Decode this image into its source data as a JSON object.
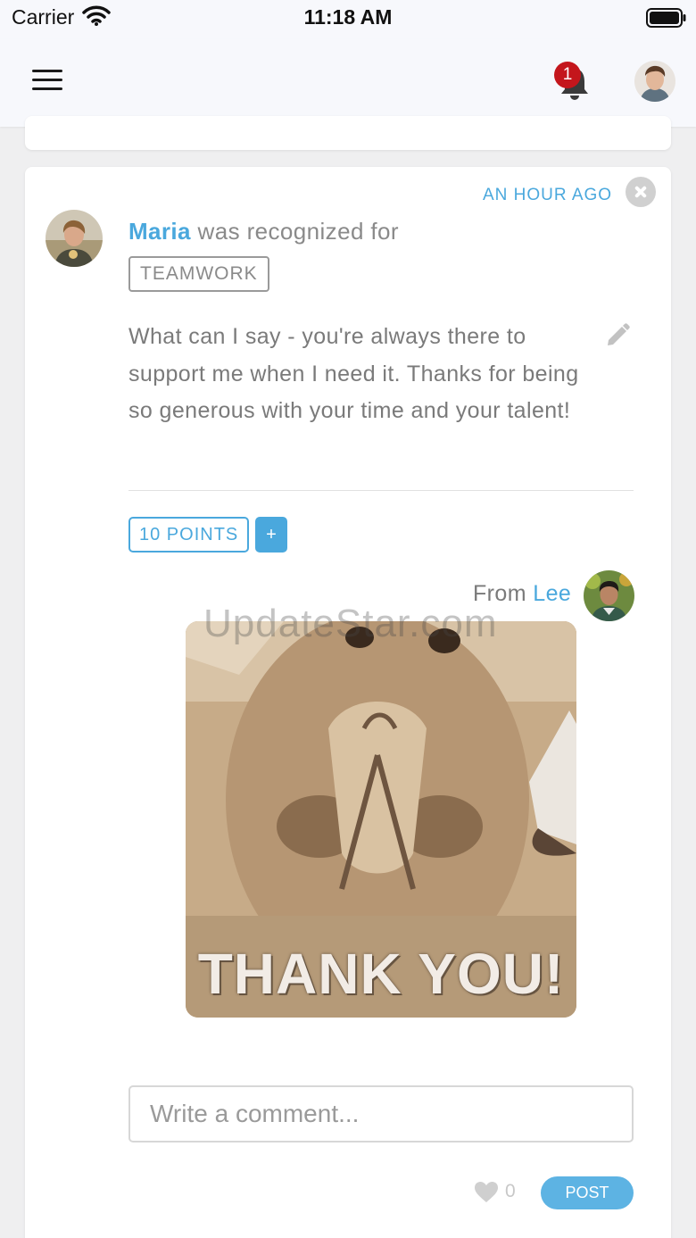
{
  "status_bar": {
    "carrier": "Carrier",
    "time": "11:18 AM"
  },
  "nav": {
    "notification_count": "1",
    "menu_icon": "hamburger-menu-icon",
    "bell_icon": "bell-icon"
  },
  "post": {
    "timestamp": "AN HOUR AGO",
    "recipient_name": "Maria",
    "headline_suffix": " was recognized for",
    "value_tag": "TEAMWORK",
    "message": "What can I say - you're always there to support me when I need it. Thanks for being so generous with your time and your talent!",
    "points": "10 POINTS",
    "add_points_label": "+",
    "from_prefix": "From ",
    "sender_name": "Lee",
    "gif_caption": "THANK YOU!",
    "watermark": "UpdateStar.com",
    "comment_placeholder": "Write a comment...",
    "like_count": "0",
    "post_button": "POST"
  },
  "colors": {
    "accent": "#4aa8dd",
    "badge": "#c4161c",
    "post_button": "#5db3e3"
  }
}
